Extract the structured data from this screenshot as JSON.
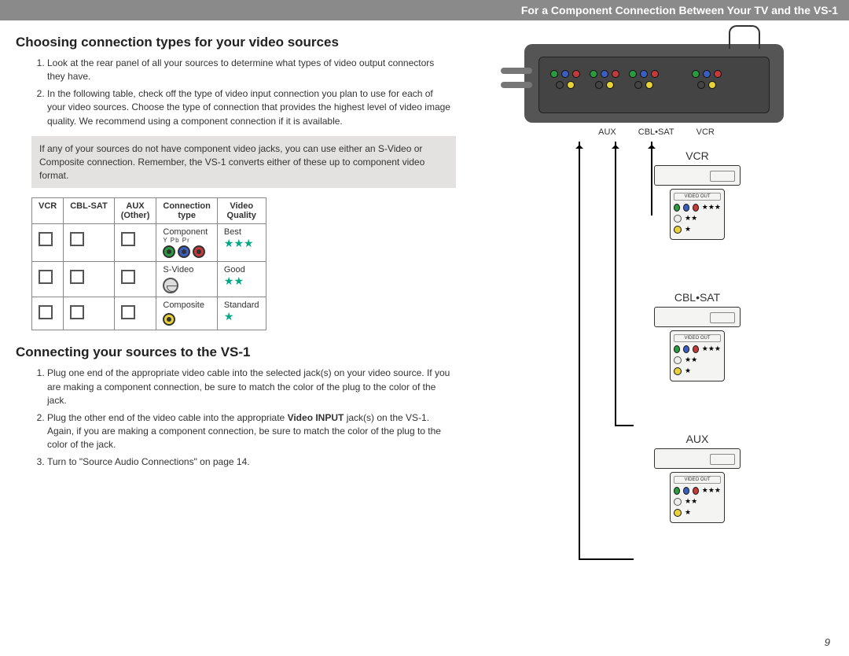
{
  "topbar": "For a Component Connection Between Your TV and the VS-1",
  "section1": {
    "heading": "Choosing connection types for your video sources",
    "items": [
      "Look at the rear panel of all your sources to determine what types of video output connectors they have.",
      "In the following table, check off the type of video input connection you plan to use for each of your video sources. Choose the type of connection that provides the highest level of video image quality. We recommend using a component connection if it is available."
    ],
    "hint": "If any of your sources do not have component video jacks, you can use either an S-Video or Composite connection. Remember, the VS-1 converts either of these up to component video format."
  },
  "table": {
    "headers": {
      "c1": "VCR",
      "c2": "CBL-SAT",
      "c3": "AUX\n(Other)",
      "c4": "Connection\ntype",
      "c5": "Video\nQuality"
    },
    "rows": [
      {
        "type": "Component",
        "sub": "Y   Pb   Pr",
        "quality": "Best",
        "stars": 3
      },
      {
        "type": "S-Video",
        "quality": "Good",
        "stars": 2
      },
      {
        "type": "Composite",
        "quality": "Standard",
        "stars": 1
      }
    ]
  },
  "section2": {
    "heading": "Connecting your sources to the VS-1",
    "items": [
      "Plug one end of the appropriate video cable into the selected jack(s) on your video source. If you are making a component connection, be sure to match the color of the plug to the color of the jack.",
      "Plug the other end of the video cable into the appropriate Video INPUT jack(s) on the VS-1. Again, if you are making a component connection, be sure to match the color of the plug to the color of the jack.",
      "Turn to \"Source Audio Connections\" on page 14."
    ],
    "bold_in_2": "Video INPUT"
  },
  "diagram": {
    "arrow_labels": [
      "AUX",
      "CBL•SAT",
      "VCR"
    ],
    "devices": [
      {
        "label": "VCR"
      },
      {
        "label": "CBL•SAT"
      },
      {
        "label": "AUX"
      }
    ],
    "jackpanel_title": "VIDEO OUT"
  },
  "pagenum": "9"
}
